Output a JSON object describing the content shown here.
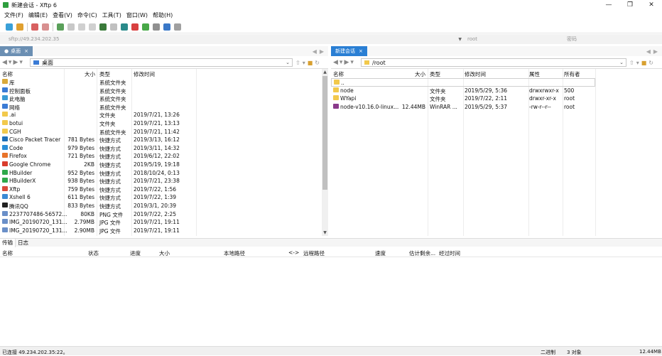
{
  "window": {
    "title": "新建会话 - Xftp 6",
    "controls": [
      "—",
      "❐",
      "✕"
    ]
  },
  "menu": [
    "文件(F)",
    "编辑(E)",
    "查看(V)",
    "命令(C)",
    "工具(T)",
    "窗口(W)",
    "帮助(H)"
  ],
  "address": {
    "host": "sftp://49.234.202.35",
    "user": "root",
    "password_placeholder": "密码"
  },
  "left": {
    "tab_label": "桌面",
    "tab_close": "×",
    "path": "桌面",
    "columns": [
      "名称",
      "大小",
      "类型",
      "修改时间"
    ],
    "files": [
      {
        "name": "库",
        "size": "",
        "type": "系统文件夹",
        "date": "",
        "icon": "library-icon",
        "color": "#d9a93a"
      },
      {
        "name": "控制面板",
        "size": "",
        "type": "系统文件夹",
        "date": "",
        "icon": "control-panel-icon",
        "color": "#3a7bd5"
      },
      {
        "name": "此电脑",
        "size": "",
        "type": "系统文件夹",
        "date": "",
        "icon": "computer-icon",
        "color": "#3a9bd5"
      },
      {
        "name": "网络",
        "size": "",
        "type": "系统文件夹",
        "date": "",
        "icon": "network-icon",
        "color": "#3a7bd5"
      },
      {
        "name": ".ai",
        "size": "",
        "type": "文件夹",
        "date": "2019/7/21, 13:26",
        "icon": "folder-icon",
        "color": "#f2c94c"
      },
      {
        "name": "botui",
        "size": "",
        "type": "文件夹",
        "date": "2019/7/21, 13:13",
        "icon": "folder-icon",
        "color": "#f2c94c"
      },
      {
        "name": "CGH",
        "size": "",
        "type": "系统文件夹",
        "date": "2019/7/21, 11:42",
        "icon": "folder-icon",
        "color": "#f2c94c"
      },
      {
        "name": "Cisco Packet Tracer",
        "size": "781 Bytes",
        "type": "快捷方式",
        "date": "2019/3/13, 16:12",
        "icon": "cisco-icon",
        "color": "#1e6fb8"
      },
      {
        "name": "Code",
        "size": "979 Bytes",
        "type": "快捷方式",
        "date": "2019/3/11, 14:32",
        "icon": "vscode-icon",
        "color": "#2a8ed8"
      },
      {
        "name": "Firefox",
        "size": "721 Bytes",
        "type": "快捷方式",
        "date": "2019/6/12, 22:02",
        "icon": "firefox-icon",
        "color": "#e8732a"
      },
      {
        "name": "Google Chrome",
        "size": "2KB",
        "type": "快捷方式",
        "date": "2019/5/19, 19:18",
        "icon": "chrome-icon",
        "color": "#d93c2c"
      },
      {
        "name": "HBuilder",
        "size": "952 Bytes",
        "type": "快捷方式",
        "date": "2018/10/24, 0:13",
        "icon": "hbuilder-icon",
        "color": "#2ea84a"
      },
      {
        "name": "HBuilderX",
        "size": "938 Bytes",
        "type": "快捷方式",
        "date": "2019/7/21, 23:38",
        "icon": "hbuilderx-icon",
        "color": "#2ea84a"
      },
      {
        "name": "Xftp",
        "size": "759 Bytes",
        "type": "快捷方式",
        "date": "2019/7/22, 1:56",
        "icon": "xftp-icon",
        "color": "#d94a3a"
      },
      {
        "name": "Xshell 6",
        "size": "611 Bytes",
        "type": "快捷方式",
        "date": "2019/7/22, 1:39",
        "icon": "xshell-icon",
        "color": "#3a8ad5"
      },
      {
        "name": "腾讯QQ",
        "size": "833 Bytes",
        "type": "快捷方式",
        "date": "2019/3/1, 20:39",
        "icon": "qq-icon",
        "color": "#222222"
      },
      {
        "name": "2237707486-56572...",
        "size": "80KB",
        "type": "PNG 文件",
        "date": "2019/7/22, 2:25",
        "icon": "image-icon",
        "color": "#6a8fc8"
      },
      {
        "name": "IMG_20190720_131...",
        "size": "2.79MB",
        "type": "JPG 文件",
        "date": "2019/7/21, 19:11",
        "icon": "image-icon",
        "color": "#6a8fc8"
      },
      {
        "name": "IMG_20190720_131...",
        "size": "2.90MB",
        "type": "JPG 文件",
        "date": "2019/7/21, 19:11",
        "icon": "image-icon",
        "color": "#6a8fc8"
      }
    ]
  },
  "right": {
    "tab_label": "新建会话",
    "tab_close": "×",
    "path": "/root",
    "columns": [
      "名称",
      "大小",
      "类型",
      "修改时间",
      "属性",
      "所有者"
    ],
    "files": [
      {
        "name": "..",
        "size": "",
        "type": "",
        "date": "",
        "attr": "",
        "owner": "",
        "icon": "folder-up-icon",
        "color": "#f2c94c"
      },
      {
        "name": "node",
        "size": "",
        "type": "文件夹",
        "date": "2019/5/29, 5:36",
        "attr": "drwxrwxr-x",
        "owner": "500",
        "icon": "folder-icon",
        "color": "#f2c94c"
      },
      {
        "name": "WYapi",
        "size": "",
        "type": "文件夹",
        "date": "2019/7/22, 2:11",
        "attr": "drwxr-xr-x",
        "owner": "root",
        "icon": "folder-icon",
        "color": "#f2c94c"
      },
      {
        "name": "node-v10.16.0-linux...",
        "size": "12.44MB",
        "type": "WinRAR ...",
        "date": "2019/5/29, 5:37",
        "attr": "-rw-r--r--",
        "owner": "root",
        "icon": "archive-icon",
        "color": "#8a3a8a"
      }
    ]
  },
  "transfer": {
    "tabs": [
      "传输",
      "日志"
    ],
    "columns": [
      "名称",
      "状态",
      "进度",
      "大小",
      "本地路径",
      "<->",
      "远程路径",
      "速度",
      "估计剩余...",
      "经过时间"
    ]
  },
  "status": {
    "connection": "已连接 49.234.202.35:22。",
    "mode": "二进制",
    "objects": "3 对象",
    "size": "12.44MB"
  }
}
